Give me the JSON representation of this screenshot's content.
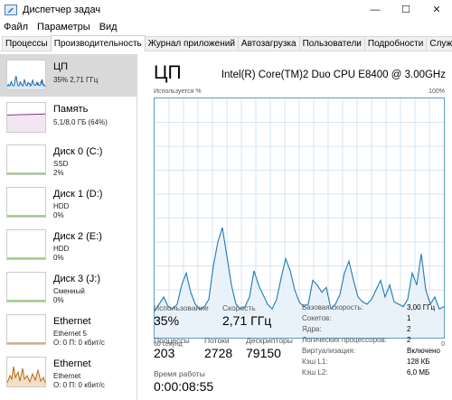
{
  "window": {
    "title": "Диспетчер задач",
    "controls": [
      "—",
      "☐",
      "✕"
    ]
  },
  "menu": [
    "Файл",
    "Параметры",
    "Вид"
  ],
  "tabs": [
    {
      "label": "Процессы",
      "active": false
    },
    {
      "label": "Производительность",
      "active": true
    },
    {
      "label": "Журнал приложений",
      "active": false
    },
    {
      "label": "Автозагрузка",
      "active": false
    },
    {
      "label": "Пользователи",
      "active": false
    },
    {
      "label": "Подробности",
      "active": false
    },
    {
      "label": "Службы",
      "active": false
    }
  ],
  "sidebar": [
    {
      "title": "ЦП",
      "line1": "35% 2,71 ГГц",
      "line2": "",
      "line3": "",
      "kind": "cpu",
      "color": "#1e6aa8",
      "fill": "#dce9f5",
      "selected": true
    },
    {
      "title": "Память",
      "line1": "5,1/8,0 ГБ (64%)",
      "line2": "",
      "line3": "",
      "kind": "mem",
      "color": "#8a2c8f",
      "fill": "#f2e6f3",
      "selected": false
    },
    {
      "title": "Диск 0 (C:)",
      "line1": "SSD",
      "line2": "2%",
      "line3": "",
      "kind": "disk",
      "color": "#4da626",
      "fill": "#eef7e8",
      "selected": false
    },
    {
      "title": "Диск 1 (D:)",
      "line1": "HDD",
      "line2": "0%",
      "line3": "",
      "kind": "disk",
      "color": "#4da626",
      "fill": "#eef7e8",
      "selected": false
    },
    {
      "title": "Диск 2 (E:)",
      "line1": "HDD",
      "line2": "0%",
      "line3": "",
      "kind": "disk",
      "color": "#4da626",
      "fill": "#eef7e8",
      "selected": false
    },
    {
      "title": "Диск 3 (J:)",
      "line1": "Сменный",
      "line2": "0%",
      "line3": "",
      "kind": "disk",
      "color": "#4da626",
      "fill": "#eef7e8",
      "selected": false
    },
    {
      "title": "Ethernet",
      "line1": "Ethernet 5",
      "line2": "О: 0 П: 0 кбит/с",
      "line3": "",
      "kind": "eth",
      "color": "#b36b12",
      "fill": "#fbf0e3",
      "selected": false
    },
    {
      "title": "Ethernet",
      "line1": "Ethernet",
      "line2": "О: 0 П: 0 кбит/с",
      "line3": "",
      "kind": "eth2",
      "color": "#b36b12",
      "fill": "#f3dfc6",
      "selected": false
    }
  ],
  "main": {
    "title": "ЦП",
    "cpu_model": "Intel(R) Core(TM)2 Duo CPU E8400 @ 3.00GHz",
    "graph_top_left": "Используется %",
    "graph_top_right": "100%",
    "graph_bottom_left": "60 секунд",
    "graph_bottom_right": "0",
    "stats": {
      "usage_label": "Использование",
      "usage_value": "35%",
      "speed_label": "Скорость",
      "speed_value": "2,71 ГГц",
      "processes_label": "Процессы",
      "processes_value": "203",
      "threads_label": "Потоки",
      "threads_value": "2728",
      "handles_label": "Дескрипторы",
      "handles_value": "79150",
      "uptime_label": "Время работы",
      "uptime_value": "0:00:08:55"
    },
    "info": [
      {
        "key": "Базовая скорость:",
        "value": "3,00 ГГц"
      },
      {
        "key": "Сокетов:",
        "value": "1"
      },
      {
        "key": "Ядра:",
        "value": "2"
      },
      {
        "key": "Логических процессоров:",
        "value": "2"
      },
      {
        "key": "Виртуализация:",
        "value": "Включено"
      },
      {
        "key": "Кэш L1:",
        "value": "128 КБ"
      },
      {
        "key": "Кэш L2:",
        "value": "6,0 МБ"
      }
    ]
  },
  "colors": {
    "cpu_line": "#1e7ab8",
    "cpu_fill": "#e8f1f8",
    "grid": "#d6e6f1"
  },
  "cpu_history_percent": [
    11,
    14,
    17,
    13,
    12,
    14,
    22,
    27,
    19,
    14,
    12,
    13,
    16,
    30,
    40,
    46,
    34,
    22,
    14,
    12,
    13,
    17,
    28,
    22,
    18,
    14,
    12,
    16,
    25,
    33,
    28,
    20,
    15,
    13,
    14,
    24,
    22,
    19,
    21,
    12,
    14,
    18,
    27,
    32,
    24,
    17,
    15,
    14,
    16,
    20,
    24,
    17,
    22,
    15,
    14,
    13,
    16,
    27,
    22,
    35,
    20,
    14,
    17,
    12,
    13
  ]
}
